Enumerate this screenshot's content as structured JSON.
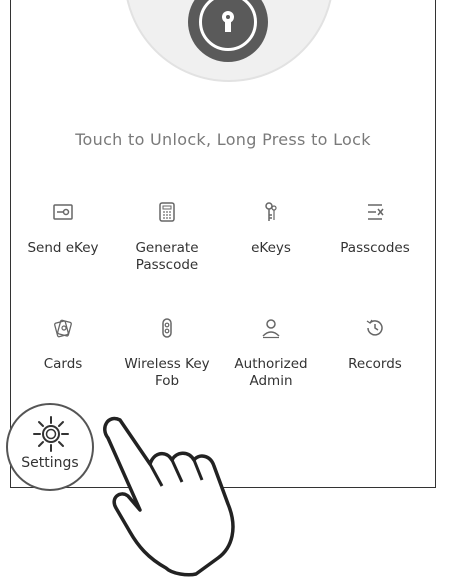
{
  "lock": {
    "hint": "Touch to Unlock, Long Press to Lock"
  },
  "menu": {
    "items": [
      {
        "label": "Send eKey",
        "icon": "send-ekey-icon"
      },
      {
        "label": "Generate Passcode",
        "icon": "generate-passcode-icon"
      },
      {
        "label": "eKeys",
        "icon": "ekeys-icon"
      },
      {
        "label": "Passcodes",
        "icon": "passcodes-icon"
      },
      {
        "label": "Cards",
        "icon": "cards-icon"
      },
      {
        "label": "Wireless Key Fob",
        "icon": "key-fob-icon"
      },
      {
        "label": "Authorized Admin",
        "icon": "authorized-admin-icon"
      },
      {
        "label": "Records",
        "icon": "records-icon"
      }
    ]
  },
  "settings": {
    "label": "Settings",
    "icon": "gear-icon"
  },
  "colors": {
    "lock_button": "#5a5a5a",
    "text": "#333333"
  }
}
